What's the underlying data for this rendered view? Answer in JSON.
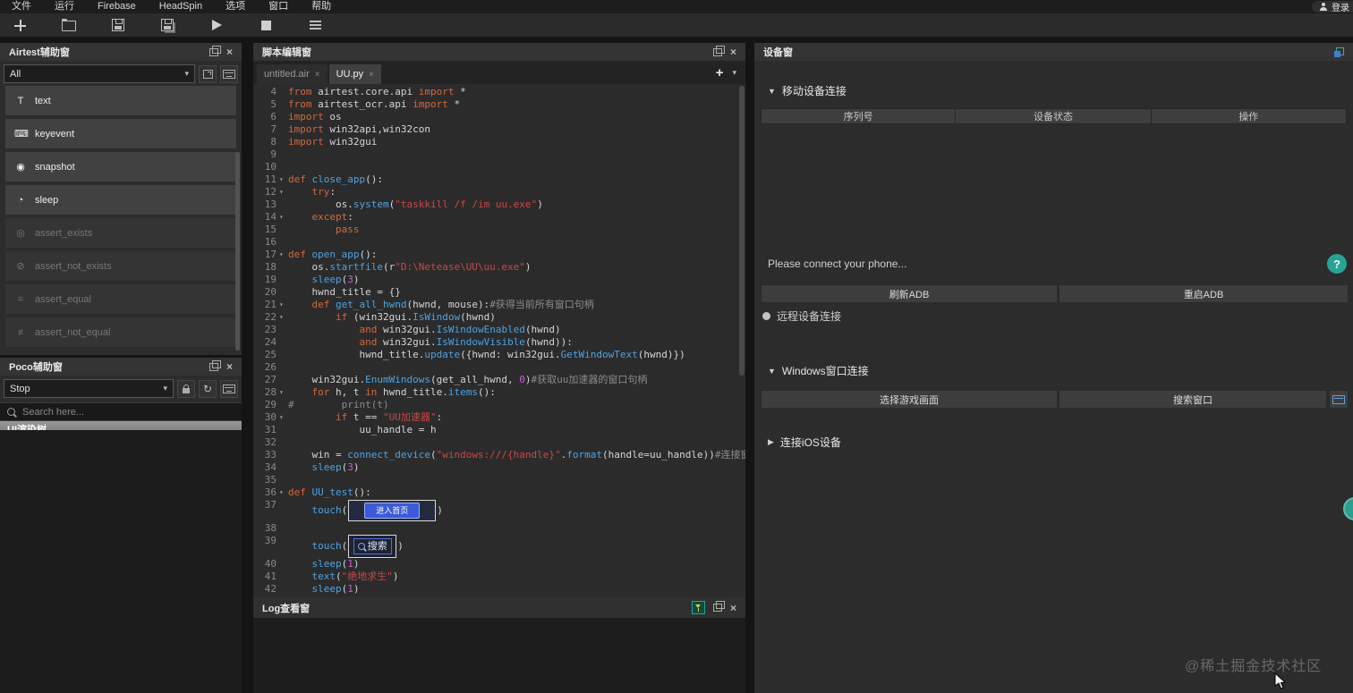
{
  "icons": {
    "close": "×",
    "chevron_down": "▾",
    "plus": "+",
    "refresh": "↻",
    "fold": "▾"
  },
  "menu_bar": {
    "items": [
      {
        "id": "file",
        "label": "文件"
      },
      {
        "id": "run",
        "label": "运行"
      },
      {
        "id": "firebase",
        "label": "Firebase"
      },
      {
        "id": "headspin",
        "label": "HeadSpin"
      },
      {
        "id": "options",
        "label": "选项"
      },
      {
        "id": "window",
        "label": "窗口"
      },
      {
        "id": "help",
        "label": "帮助"
      }
    ],
    "login_label": "登录"
  },
  "toolbar": {
    "buttons": [
      {
        "id": "new-file"
      },
      {
        "id": "open-folder"
      },
      {
        "id": "save"
      },
      {
        "id": "save-all"
      },
      {
        "id": "run-script"
      },
      {
        "id": "stop-script"
      },
      {
        "id": "log-report"
      }
    ]
  },
  "airtest_panel": {
    "title": "Airtest辅助窗",
    "filter_value": "All",
    "items": [
      {
        "label": "text",
        "glyph": "T",
        "enabled": true
      },
      {
        "label": "keyevent",
        "glyph": "⌨",
        "enabled": true
      },
      {
        "label": "snapshot",
        "glyph": "◉",
        "enabled": true
      },
      {
        "label": "sleep",
        "glyph": "◔",
        "enabled": true
      },
      {
        "label": "assert_exists",
        "glyph": "◎",
        "enabled": false
      },
      {
        "label": "assert_not_exists",
        "glyph": "⊘",
        "enabled": false
      },
      {
        "label": "assert_equal",
        "glyph": "=",
        "enabled": false
      },
      {
        "label": "assert_not_equal",
        "glyph": "≠",
        "enabled": false
      }
    ]
  },
  "poco_panel": {
    "title": "Poco辅助窗",
    "mode_value": "Stop",
    "search_placeholder": "Search here...",
    "tree_label": "UI渲染树"
  },
  "editor_panel": {
    "title": "脚本编辑窗",
    "tabs": [
      {
        "label": "untitled.air",
        "active": false
      },
      {
        "label": "UU.py",
        "active": true
      }
    ],
    "code": {
      "lines": [
        {
          "n": 4,
          "t": [
            [
              "kw",
              "from"
            ],
            [
              "pl",
              " airtest.core.api "
            ],
            [
              "kw",
              "import"
            ],
            [
              "pl",
              " *"
            ]
          ]
        },
        {
          "n": 5,
          "t": [
            [
              "kw",
              "from"
            ],
            [
              "pl",
              " airtest_ocr.api "
            ],
            [
              "kw",
              "import"
            ],
            [
              "pl",
              " *"
            ]
          ]
        },
        {
          "n": 6,
          "t": [
            [
              "kw",
              "import"
            ],
            [
              "pl",
              " os"
            ]
          ]
        },
        {
          "n": 7,
          "t": [
            [
              "kw",
              "import"
            ],
            [
              "pl",
              " win32api,win32con"
            ]
          ]
        },
        {
          "n": 8,
          "t": [
            [
              "kw",
              "import"
            ],
            [
              "pl",
              " win32gui"
            ]
          ]
        },
        {
          "n": 9,
          "t": []
        },
        {
          "n": 10,
          "t": []
        },
        {
          "n": 11,
          "f": true,
          "t": [
            [
              "kw",
              "def"
            ],
            [
              "fn",
              " close_app"
            ],
            [
              "pl",
              "():"
            ]
          ]
        },
        {
          "n": 12,
          "f": true,
          "t": [
            [
              "pl",
              "    "
            ],
            [
              "kw",
              "try"
            ],
            [
              "pl",
              ":"
            ]
          ]
        },
        {
          "n": 13,
          "t": [
            [
              "pl",
              "        os."
            ],
            [
              "fn",
              "system"
            ],
            [
              "pl",
              "("
            ],
            [
              "str",
              "\"taskkill /f /im uu.exe\""
            ],
            [
              "pl",
              ")"
            ]
          ]
        },
        {
          "n": 14,
          "f": true,
          "t": [
            [
              "pl",
              "    "
            ],
            [
              "kw",
              "except"
            ],
            [
              "pl",
              ":"
            ]
          ]
        },
        {
          "n": 15,
          "t": [
            [
              "pl",
              "        "
            ],
            [
              "kw",
              "pass"
            ]
          ]
        },
        {
          "n": 16,
          "t": []
        },
        {
          "n": 17,
          "f": true,
          "t": [
            [
              "kw",
              "def"
            ],
            [
              "fn",
              " open_app"
            ],
            [
              "pl",
              "():"
            ]
          ]
        },
        {
          "n": 18,
          "t": [
            [
              "pl",
              "    os."
            ],
            [
              "fn",
              "startfile"
            ],
            [
              "pl",
              "(r"
            ],
            [
              "str",
              "\"D:\\Netease\\UU\\uu.exe\""
            ],
            [
              "pl",
              ")"
            ]
          ]
        },
        {
          "n": 19,
          "t": [
            [
              "pl",
              "    "
            ],
            [
              "fn",
              "sleep"
            ],
            [
              "pl",
              "("
            ],
            [
              "num",
              "3"
            ],
            [
              "pl",
              ")"
            ]
          ]
        },
        {
          "n": 20,
          "t": [
            [
              "pl",
              "    hwnd_title = {}"
            ]
          ]
        },
        {
          "n": 21,
          "f": true,
          "t": [
            [
              "pl",
              "    "
            ],
            [
              "kw",
              "def"
            ],
            [
              "fn",
              " get_all_hwnd"
            ],
            [
              "pl",
              "(hwnd, mouse):"
            ],
            [
              "com",
              "#获得当前所有窗口句柄"
            ]
          ]
        },
        {
          "n": 22,
          "f": true,
          "t": [
            [
              "pl",
              "        "
            ],
            [
              "kw",
              "if"
            ],
            [
              "pl",
              " (win32gui."
            ],
            [
              "fn",
              "IsWindow"
            ],
            [
              "pl",
              "(hwnd)"
            ]
          ]
        },
        {
          "n": 23,
          "t": [
            [
              "pl",
              "            "
            ],
            [
              "kw",
              "and"
            ],
            [
              "pl",
              " win32gui."
            ],
            [
              "fn",
              "IsWindowEnabled"
            ],
            [
              "pl",
              "(hwnd)"
            ]
          ]
        },
        {
          "n": 24,
          "t": [
            [
              "pl",
              "            "
            ],
            [
              "kw",
              "and"
            ],
            [
              "pl",
              " win32gui."
            ],
            [
              "fn",
              "IsWindowVisible"
            ],
            [
              "pl",
              "(hwnd)):"
            ]
          ]
        },
        {
          "n": 25,
          "t": [
            [
              "pl",
              "            hwnd_title."
            ],
            [
              "fn",
              "update"
            ],
            [
              "pl",
              "({hwnd: win32gui."
            ],
            [
              "fn",
              "GetWindowText"
            ],
            [
              "pl",
              "(hwnd)})"
            ]
          ]
        },
        {
          "n": 26,
          "t": []
        },
        {
          "n": 27,
          "t": [
            [
              "pl",
              "    win32gui."
            ],
            [
              "fn",
              "EnumWindows"
            ],
            [
              "pl",
              "(get_all_hwnd, "
            ],
            [
              "num",
              "0"
            ],
            [
              "pl",
              ")"
            ],
            [
              "com",
              "#获取uu加速器的窗口句柄"
            ]
          ]
        },
        {
          "n": 28,
          "f": true,
          "t": [
            [
              "pl",
              "    "
            ],
            [
              "kw",
              "for"
            ],
            [
              "pl",
              " h, t "
            ],
            [
              "kw",
              "in"
            ],
            [
              "pl",
              " hwnd_title."
            ],
            [
              "fn",
              "items"
            ],
            [
              "pl",
              "():"
            ]
          ]
        },
        {
          "n": 29,
          "t": [
            [
              "com",
              "#        print(t)"
            ]
          ]
        },
        {
          "n": 30,
          "f": true,
          "t": [
            [
              "pl",
              "        "
            ],
            [
              "kw",
              "if"
            ],
            [
              "pl",
              " t == "
            ],
            [
              "str",
              "\"UU加速器\""
            ],
            [
              "pl",
              ":"
            ]
          ]
        },
        {
          "n": 31,
          "t": [
            [
              "pl",
              "            uu_handle = h"
            ]
          ]
        },
        {
          "n": 32,
          "t": []
        },
        {
          "n": 33,
          "t": [
            [
              "pl",
              "    win = "
            ],
            [
              "fn",
              "connect_device"
            ],
            [
              "pl",
              "("
            ],
            [
              "str",
              "\"windows:///{handle}\""
            ],
            [
              "pl",
              "."
            ],
            [
              "fn",
              "format"
            ],
            [
              "pl",
              "(handle=uu_handle))"
            ],
            [
              "com",
              "#连接窗口"
            ]
          ]
        },
        {
          "n": 34,
          "t": [
            [
              "pl",
              "    "
            ],
            [
              "fn",
              "sleep"
            ],
            [
              "pl",
              "("
            ],
            [
              "num",
              "3"
            ],
            [
              "pl",
              ")"
            ]
          ]
        },
        {
          "n": 35,
          "t": []
        },
        {
          "n": 36,
          "f": true,
          "t": [
            [
              "kw",
              "def"
            ],
            [
              "fn",
              " UU_test"
            ],
            [
              "pl",
              "():"
            ]
          ]
        },
        {
          "n": 37,
          "img": "home",
          "t": [
            [
              "pl",
              "    "
            ],
            [
              "fn",
              "touch"
            ],
            [
              "pl",
              "("
            ]
          ]
        },
        {
          "n": 38,
          "t": []
        },
        {
          "n": 39,
          "img": "search",
          "t": [
            [
              "pl",
              "    "
            ],
            [
              "fn",
              "touch"
            ],
            [
              "pl",
              "("
            ]
          ]
        },
        {
          "n": 40,
          "t": [
            [
              "pl",
              "    "
            ],
            [
              "fn",
              "sleep"
            ],
            [
              "pl",
              "("
            ],
            [
              "num",
              "1"
            ],
            [
              "pl",
              ")"
            ]
          ]
        },
        {
          "n": 41,
          "t": [
            [
              "pl",
              "    "
            ],
            [
              "fn",
              "text"
            ],
            [
              "pl",
              "("
            ],
            [
              "str",
              "\"绝地求生\""
            ],
            [
              "pl",
              ")"
            ]
          ]
        },
        {
          "n": 42,
          "t": [
            [
              "pl",
              "    "
            ],
            [
              "fn",
              "sleep"
            ],
            [
              "pl",
              "("
            ],
            [
              "num",
              "1"
            ],
            [
              "pl",
              ")"
            ]
          ]
        }
      ]
    }
  },
  "embedded_images": {
    "home_button_label": "进入首页",
    "search_label": "搜索"
  },
  "log_panel": {
    "title": "Log查看窗"
  },
  "device_panel": {
    "title": "设备窗",
    "sections": {
      "mobile": {
        "icon": "▼",
        "label": "移动设备连接"
      },
      "windows": {
        "icon": "▼",
        "label": "Windows窗口连接"
      },
      "ios": {
        "icon": "▶",
        "label": "连接iOS设备"
      }
    },
    "table_headers": [
      "序列号",
      "设备状态",
      "操作"
    ],
    "hint": "Please connect your phone...",
    "help_label": "?",
    "remote_label": "远程设备连接",
    "buttons": {
      "refresh_adb": "刷新ADB",
      "restart_adb": "重启ADB",
      "select_game": "选择游戏画面",
      "search_window": "搜索窗口"
    }
  },
  "watermark": "@稀土掘金技术社区"
}
